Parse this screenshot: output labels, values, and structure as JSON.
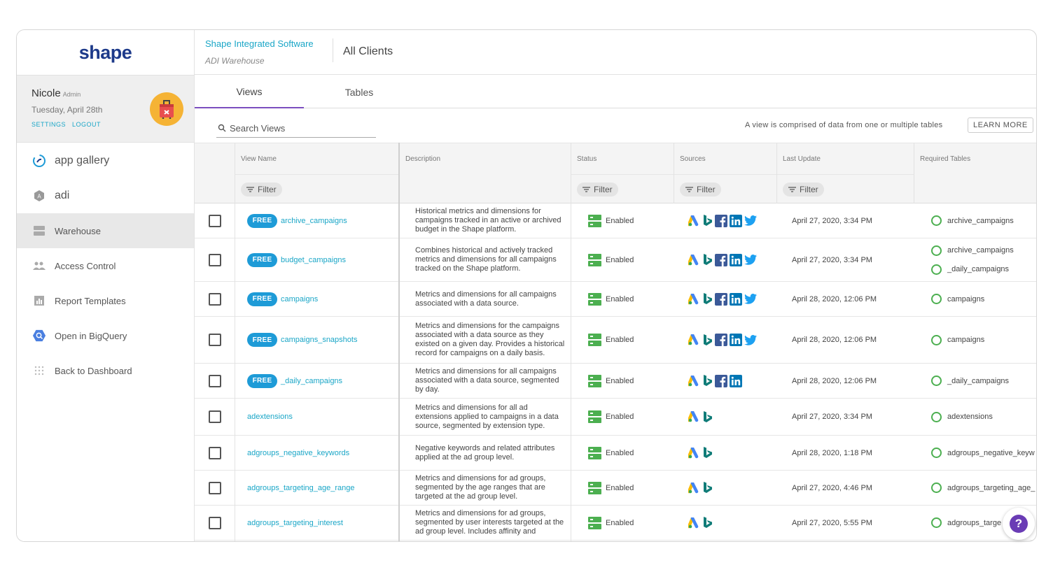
{
  "app": {
    "logo_text": "shape"
  },
  "profile": {
    "name": "Nicole",
    "role": "Admin",
    "date": "Tuesday, April 28th",
    "settings_label": "SETTINGS",
    "logout_label": "LOGOUT"
  },
  "sidebar": {
    "items": [
      {
        "label": "app gallery",
        "icon": "app-gallery-icon"
      },
      {
        "label": "adi",
        "icon": "adi-icon"
      },
      {
        "label": "Warehouse",
        "icon": "warehouse-icon",
        "active": true
      },
      {
        "label": "Access Control",
        "icon": "people-icon"
      },
      {
        "label": "Report Templates",
        "icon": "bar-chart-icon"
      },
      {
        "label": "Open in BigQuery",
        "icon": "bigquery-icon"
      },
      {
        "label": "Back to Dashboard",
        "icon": "grid-icon"
      }
    ]
  },
  "header": {
    "company": "Shape Integrated Software",
    "warehouse": "ADI Warehouse",
    "clients": "All Clients"
  },
  "tabs": [
    {
      "label": "Views",
      "active": true
    },
    {
      "label": "Tables"
    }
  ],
  "search": {
    "placeholder": "Search Views"
  },
  "info_text": "A view is comprised of data from one or multiple tables",
  "learn_more_label": "LEARN MORE",
  "table": {
    "columns": [
      "View Name",
      "Description",
      "Status",
      "Sources",
      "Last Update",
      "Required Tables"
    ],
    "filter_label": "Filter",
    "free_label": "FREE",
    "rows": [
      {
        "free": true,
        "name": "archive_campaigns",
        "desc": "Historical metrics and dimensions for campaigns tracked in an active or archived budget in the Shape platform.",
        "status": "Enabled",
        "sources": [
          "google-ads",
          "bing",
          "facebook",
          "linkedin",
          "twitter"
        ],
        "updated": "April 27, 2020, 3:34 PM",
        "required": [
          "archive_campaigns"
        ]
      },
      {
        "free": true,
        "name": "budget_campaigns",
        "desc": "Combines historical and actively tracked metrics and dimensions for all campaigns tracked on the Shape platform.",
        "status": "Enabled",
        "sources": [
          "google-ads",
          "bing",
          "facebook",
          "linkedin",
          "twitter"
        ],
        "updated": "April 27, 2020, 3:34 PM",
        "required": [
          "archive_campaigns",
          "_daily_campaigns"
        ]
      },
      {
        "free": true,
        "name": "campaigns",
        "desc": "Metrics and dimensions for all campaigns associated with a data source.",
        "status": "Enabled",
        "sources": [
          "google-ads",
          "bing",
          "facebook",
          "linkedin",
          "twitter"
        ],
        "updated": "April 28, 2020, 12:06 PM",
        "required": [
          "campaigns"
        ]
      },
      {
        "free": true,
        "name": "campaigns_snapshots",
        "desc": "Metrics and dimensions for the campaigns associated with a data source as they existed on a given day. Provides a historical record for campaigns on a daily basis.",
        "status": "Enabled",
        "sources": [
          "google-ads",
          "bing",
          "facebook",
          "linkedin",
          "twitter"
        ],
        "updated": "April 28, 2020, 12:06 PM",
        "required": [
          "campaigns"
        ]
      },
      {
        "free": true,
        "name": "_daily_campaigns",
        "desc": "Metrics and dimensions for all campaigns associated with a data source, segmented by day.",
        "status": "Enabled",
        "sources": [
          "google-ads",
          "bing",
          "facebook",
          "linkedin"
        ],
        "updated": "April 28, 2020, 12:06 PM",
        "required": [
          "_daily_campaigns"
        ]
      },
      {
        "free": false,
        "name": "adextensions",
        "desc": "Metrics and dimensions for all ad extensions applied to campaigns in a data source, segmented by extension type.",
        "status": "Enabled",
        "sources": [
          "google-ads",
          "bing"
        ],
        "updated": "April 27, 2020, 3:34 PM",
        "required": [
          "adextensions"
        ]
      },
      {
        "free": false,
        "name": "adgroups_negative_keywords",
        "desc": "Negative keywords and related attributes applied at the ad group level.",
        "status": "Enabled",
        "sources": [
          "google-ads",
          "bing"
        ],
        "updated": "April 28, 2020, 1:18 PM",
        "required": [
          "adgroups_negative_keyw"
        ]
      },
      {
        "free": false,
        "name": "adgroups_targeting_age_range",
        "desc": "Metrics and dimensions for ad groups, segmented by the age ranges that are targeted at the ad group level.",
        "status": "Enabled",
        "sources": [
          "google-ads",
          "bing"
        ],
        "updated": "April 27, 2020, 4:46 PM",
        "required": [
          "adgroups_targeting_age_"
        ]
      },
      {
        "free": false,
        "name": "adgroups_targeting_interest",
        "desc": "Metrics and dimensions for ad groups, segmented by user interests targeted at the ad group level. Includes affinity and",
        "status": "Enabled",
        "sources": [
          "google-ads",
          "bing"
        ],
        "updated": "April 27, 2020, 5:55 PM",
        "required": [
          "adgroups_targe"
        ]
      }
    ]
  },
  "help_label": "?",
  "colors": {
    "accent": "#1aa6c7",
    "badge": "#1e9bd7",
    "tab_indicator": "#7b4fbf",
    "status_green": "#4caf50",
    "help": "#6a3cb5"
  }
}
